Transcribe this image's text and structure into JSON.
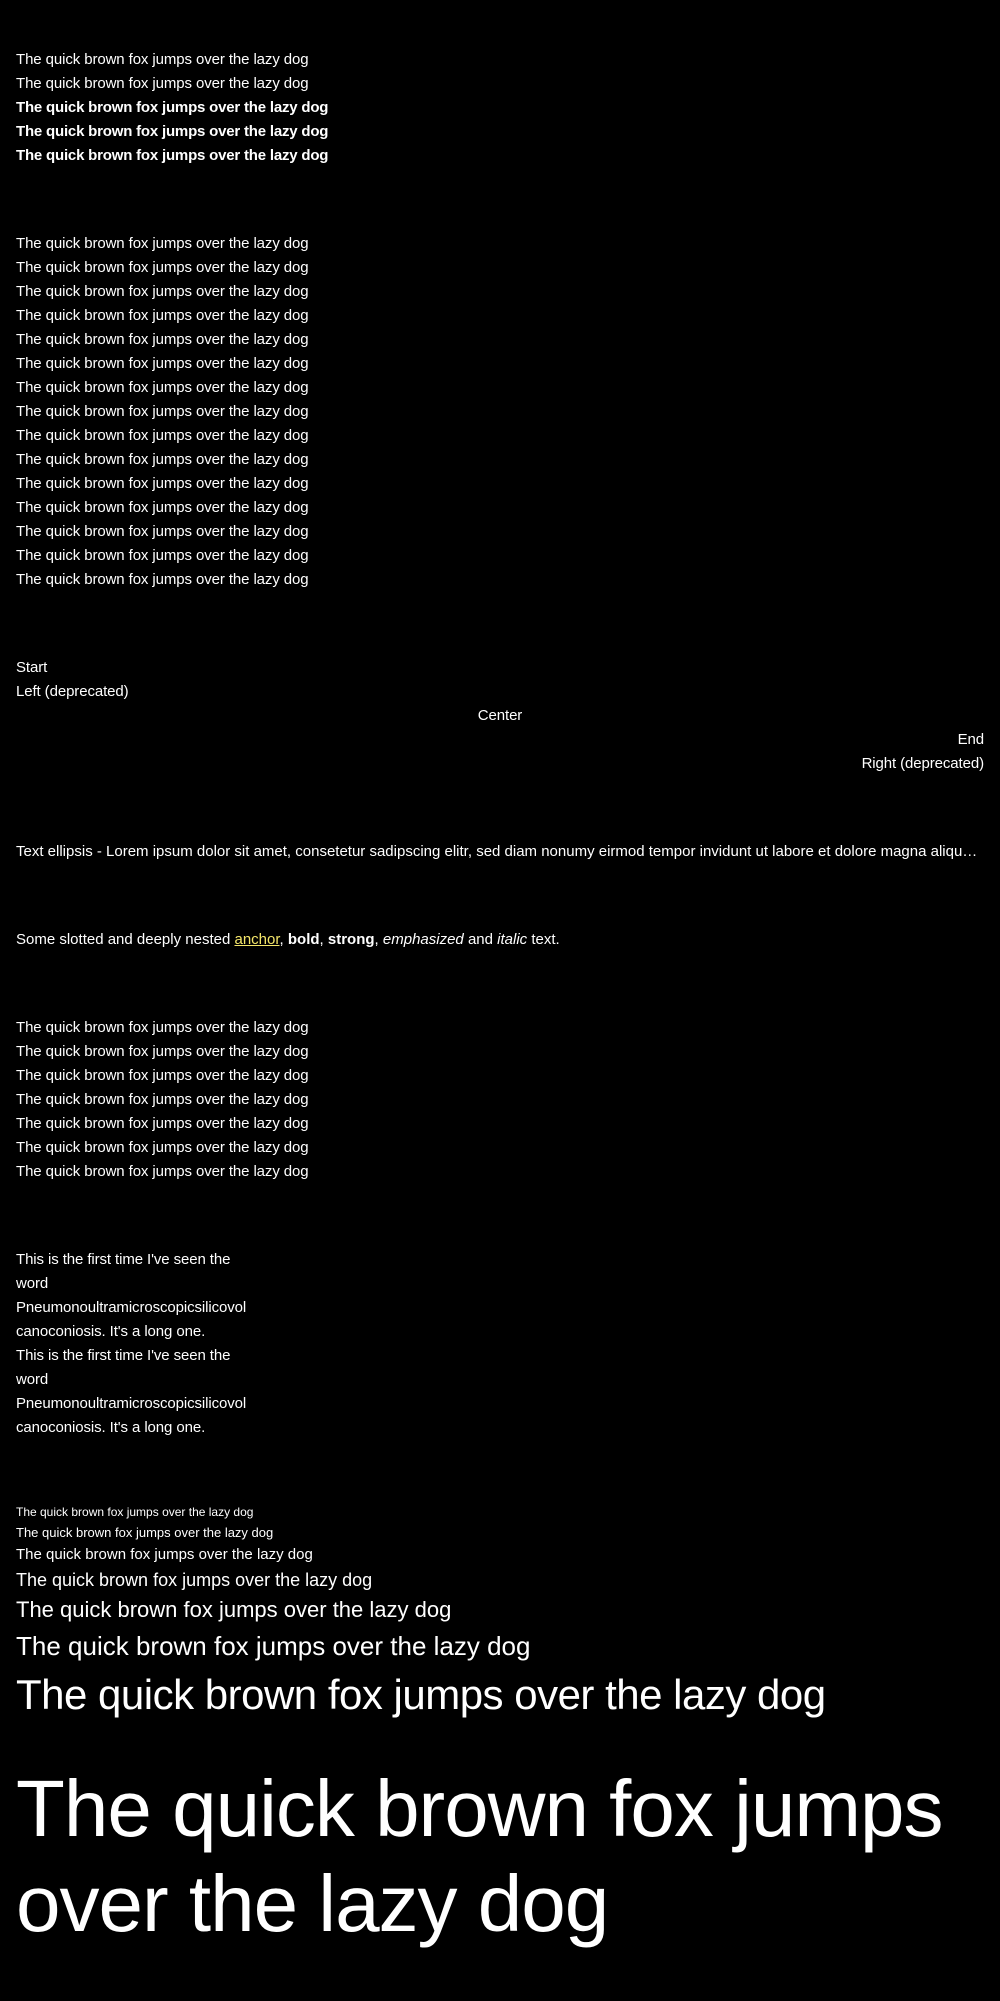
{
  "weights": {
    "lines": [
      {
        "text": "The quick brown fox jumps over the lazy dog",
        "weight": "regular"
      },
      {
        "text": "The quick brown fox jumps over the lazy dog",
        "weight": "regular"
      },
      {
        "text": "The quick brown fox jumps over the lazy dog",
        "weight": "semibold"
      },
      {
        "text": "The quick brown fox jumps over the lazy dog",
        "weight": "bold"
      },
      {
        "text": "The quick brown fox jumps over the lazy dog",
        "weight": "bold"
      }
    ]
  },
  "colors_section": {
    "lines": [
      {
        "text": "The quick brown fox jumps over the lazy dog"
      },
      {
        "text": "The quick brown fox jumps over the lazy dog"
      },
      {
        "text": "The quick brown fox jumps over the lazy dog"
      },
      {
        "text": "The quick brown fox jumps over the lazy dog"
      },
      {
        "text": "The quick brown fox jumps over the lazy dog"
      },
      {
        "text": "The quick brown fox jumps over the lazy dog"
      },
      {
        "text": "The quick brown fox jumps over the lazy dog"
      },
      {
        "text": "The quick brown fox jumps over the lazy dog"
      },
      {
        "text": "The quick brown fox jumps over the lazy dog"
      },
      {
        "text": "The quick brown fox jumps over the lazy dog"
      },
      {
        "text": "The quick brown fox jumps over the lazy dog"
      },
      {
        "text": "The quick brown fox jumps over the lazy dog"
      },
      {
        "text": "The quick brown fox jumps over the lazy dog"
      },
      {
        "text": "The quick brown fox jumps over the lazy dog"
      },
      {
        "text": "The quick brown fox jumps over the lazy dog"
      }
    ]
  },
  "alignment": {
    "lines": [
      {
        "text": "Start",
        "align": "start"
      },
      {
        "text": "Left (deprecated)",
        "align": "left"
      },
      {
        "text": "Center",
        "align": "center"
      },
      {
        "text": "End",
        "align": "end"
      },
      {
        "text": "Right (deprecated)",
        "align": "right"
      }
    ]
  },
  "ellipsis": {
    "text": "Text ellipsis - Lorem ipsum dolor sit amet, consetetur sadipscing elitr, sed diam nonumy eirmod tempor invidunt ut labore et dolore magna aliquyam erat, sed diam voluptua."
  },
  "slotted": {
    "prefix": "Some slotted and deeply nested ",
    "anchor": "anchor",
    "sep1": ", ",
    "bold": "bold",
    "sep2": ", ",
    "strong": "strong",
    "sep3": ", ",
    "emphasized": "emphasized",
    "sep4": " and ",
    "italic": "italic",
    "suffix": " text.",
    "anchor_color": "#f4e66a"
  },
  "tags_section": {
    "lines": [
      {
        "text": "The quick brown fox jumps over the lazy dog"
      },
      {
        "text": "The quick brown fox jumps over the lazy dog"
      },
      {
        "text": "The quick brown fox jumps over the lazy dog"
      },
      {
        "text": "The quick brown fox jumps over the lazy dog"
      },
      {
        "text": "The quick brown fox jumps over the lazy dog"
      },
      {
        "text": "The quick brown fox jumps over the lazy dog"
      },
      {
        "text": "The quick brown fox jumps over the lazy dog"
      }
    ]
  },
  "hyphenation": {
    "paragraphs": [
      {
        "lines": [
          "This is the first time I've seen the",
          "word",
          "Pneumonoultramicroscopicsilicovol",
          "canoconiosis. It's a long one."
        ]
      },
      {
        "lines": [
          "This is the first time I've seen the",
          "word",
          "Pneumonoultramicroscopicsilicovol",
          "canoconiosis. It's a long one."
        ]
      }
    ]
  },
  "sizes": {
    "lines": [
      {
        "text": "The quick brown fox jumps over the lazy dog",
        "size": "xx-small"
      },
      {
        "text": "The quick brown fox jumps over the lazy dog",
        "size": "x-small"
      },
      {
        "text": "The quick brown fox jumps over the lazy dog",
        "size": "small"
      },
      {
        "text": "The quick brown fox jumps over the lazy dog",
        "size": "medium"
      },
      {
        "text": "The quick brown fox jumps over the lazy dog",
        "size": "large"
      },
      {
        "text": "The quick brown fox jumps over the lazy dog",
        "size": "x-large"
      },
      {
        "text": "The quick brown fox jumps over the lazy dog",
        "size": "xx-large"
      },
      {
        "text": "The quick brown fox jumps over the lazy dog",
        "size": "huge"
      }
    ]
  },
  "colors": {
    "background": "#000000",
    "text": "#ffffff",
    "link": "#f4e66a"
  }
}
